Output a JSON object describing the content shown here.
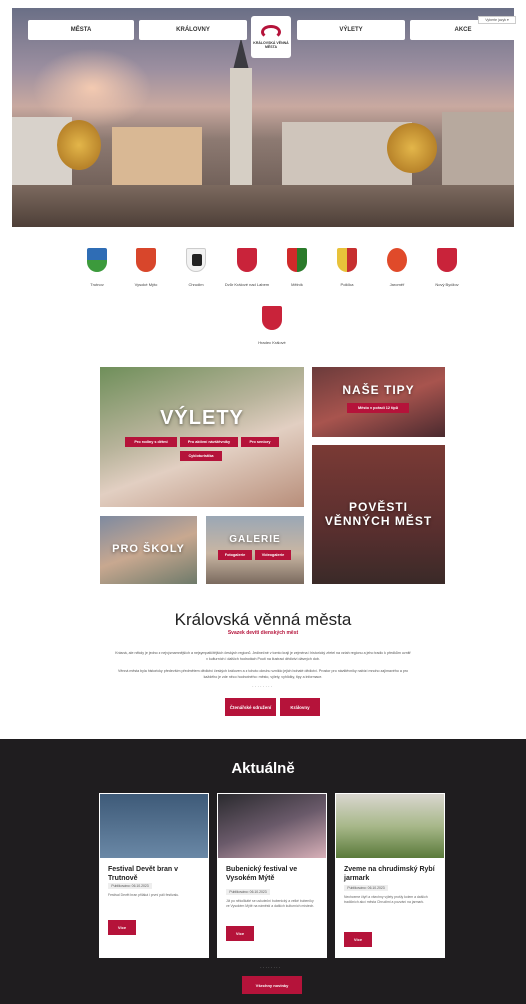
{
  "nav": {
    "items": [
      "MĚSTA",
      "KRÁLOVNY",
      "VÝLETY",
      "AKCE"
    ],
    "logo_text": "KRÁLOVSKÁ VĚNNÁ MĚSTA",
    "lang": "Vyberte jazyk"
  },
  "cities": [
    "Trutnov",
    "Vysoké Mýto",
    "Chrudim",
    "Dvůr Králové nad Labem",
    "Mělník",
    "Polička",
    "Jaroměř",
    "Nový Bydžov",
    "Hradec Králové"
  ],
  "tiles": {
    "vylety": {
      "title": "VÝLETY",
      "buttons": [
        "Pro rodiny s dětmi",
        "Pro aktivní návštěvníky",
        "Pro seniory",
        "Cykloturistika"
      ]
    },
    "tipy": {
      "title": "NAŠE TIPY",
      "sub": "Město v pořadí 12 tipů"
    },
    "skoly": {
      "title": "PRO ŠKOLY"
    },
    "galerie": {
      "title": "GALERIE",
      "buttons": [
        "Fotogalerie",
        "Videogalerie"
      ]
    },
    "povesti": {
      "title": "POVĚSTI VĚNNÝCH MĚST"
    }
  },
  "about": {
    "title": "Královská věnná města",
    "subtitle": "Svazek devíti dienských měst",
    "p1": "Krásná, ale někdy je jedno z nejvýznamnějších a nejsympatičtějších českých regionů. Jedinečné v tomto kraji je zejména i historický zřetel na vztah regionu a jeho tradic k předkům uvnitř v kulturních i dalších hodnotách Poutí na ilustraci dědictví dávných dob.",
    "p2": "Věnná města byla historicky především předmětem dědictví českých královen a z tohoto okruhu vzniklo jejich bohaté dědictví. Prostor pro návštěvníky nabízí mnoho zajímavého a pro každého je zde něco hodnotného: město, výlety, vyhlídky, tipy a informace.",
    "btn_about": "Čtenářské sdružení",
    "btn_queens": "Královny"
  },
  "news": {
    "title": "Aktuálně",
    "cards": [
      {
        "title": "Festival Devět bran v Trutnově",
        "date": "Publikováno: 06.10.2023",
        "text": "Festival Devět bran přiláká i první pálí festivalu.",
        "btn": "Více"
      },
      {
        "title": "Bubenický festival ve Vysokém Mýtě",
        "date": "Publikováno: 06.10.2023",
        "text": "Již po několikáté se uskuteční bubenický a velké bubeníky ve Vysokém Mýtě na náměstí a dalších kulturních místech.",
        "btn": "Více"
      },
      {
        "title": "Zveme na chrudimský Rybí jarmark",
        "date": "Publikováno: 06.10.2023",
        "text": "Nechceme čtyři a všechny výlety prošly kolem a dalších tradičních akcí města Chrudimi a pozvání na jarmark.",
        "btn": "Více"
      }
    ],
    "all_btn": "Všechny novinky"
  },
  "colors": {
    "accent": "#b5133a",
    "dark": "#1f1d1f"
  }
}
